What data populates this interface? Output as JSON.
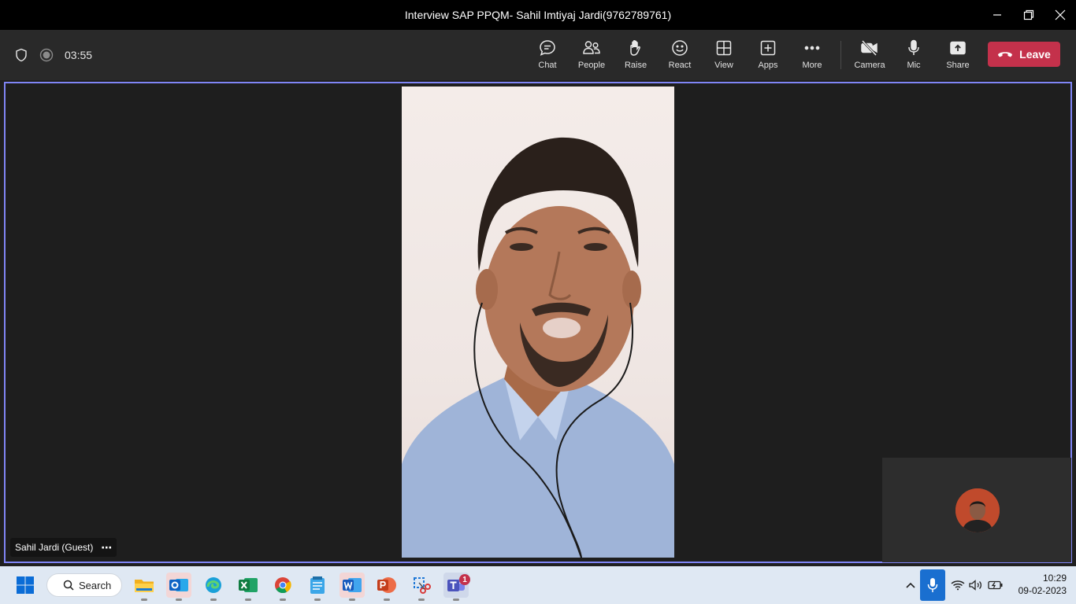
{
  "window": {
    "title": "Interview SAP PPQM- Sahil Imtiyaj Jardi(9762789761)"
  },
  "meeting": {
    "timer": "03:55",
    "toolbar": [
      {
        "label": "Chat",
        "icon": "chat-icon"
      },
      {
        "label": "People",
        "icon": "people-icon"
      },
      {
        "label": "Raise",
        "icon": "raise-hand-icon"
      },
      {
        "label": "React",
        "icon": "smiley-icon"
      },
      {
        "label": "View",
        "icon": "grid-view-icon"
      },
      {
        "label": "Apps",
        "icon": "apps-plus-icon"
      },
      {
        "label": "More",
        "icon": "ellipsis-icon"
      },
      {
        "label": "Camera",
        "icon": "camera-off-icon"
      },
      {
        "label": "Mic",
        "icon": "mic-icon"
      },
      {
        "label": "Share",
        "icon": "share-icon"
      }
    ],
    "leave_label": "Leave",
    "participant_name": "Sahil Jardi (Guest)",
    "participant_menu": "⋯"
  },
  "colors": {
    "accent": "#7f85f5",
    "leave": "#c4314b",
    "taskbar": "#dfe8f3"
  },
  "taskbar": {
    "search_label": "Search",
    "apps": [
      "start-icon",
      "file-explorer-icon",
      "outlook-icon",
      "edge-icon",
      "excel-icon",
      "chrome-icon",
      "notepad-icon",
      "word-icon",
      "powerpoint-icon",
      "snipping-tool-icon",
      "teams-icon"
    ],
    "teams_badge": "1",
    "time": "10:29",
    "date": "09-02-2023"
  }
}
